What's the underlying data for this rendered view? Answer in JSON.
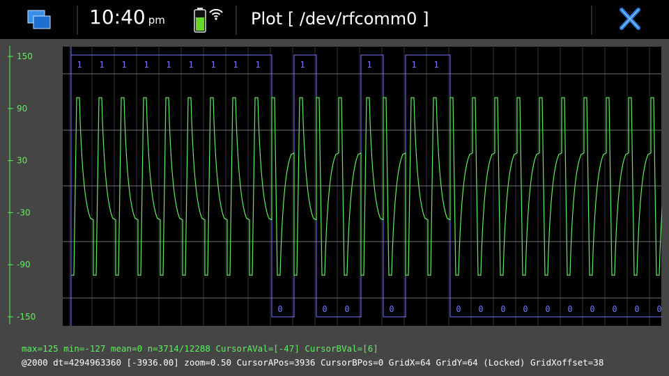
{
  "topbar": {
    "time": "10:40",
    "ampm": "pm",
    "title": "Plot [ /dev/rfcomm0 ]"
  },
  "icons": {
    "switcher": "task-switcher-icon",
    "battery": "battery-icon",
    "signal": "wifi-signal-icon",
    "close": "close-icon"
  },
  "colors": {
    "signal": "#5ef05e",
    "cursor": "#7a78ff",
    "grid": "#6e6e6e",
    "axis": "#5ef05e",
    "close": "#2a7fe0"
  },
  "status": {
    "line1": "max=125  min=-127  mean=0  n=3714/12288  CursorAVal=[-47]  CursorBVal=[6]",
    "line2": "@2000  dt=4294963360 [-3936.00] zoom=0.50  CursorAPos=3936  CursorBPos=0  GridX=64  GridY=64 (Locked) GridXoffset=38"
  },
  "chart_data": {
    "type": "line",
    "yticks": [
      "150",
      "90",
      "30",
      "-30",
      "-90",
      "-150"
    ],
    "ylim": [
      -150,
      150
    ],
    "grid": true,
    "signal": {
      "range": [
        -127,
        125
      ],
      "period_markers": [
        {
          "label": "1",
          "high": true
        },
        {
          "label": "1",
          "high": true
        },
        {
          "label": "1",
          "high": true
        },
        {
          "label": "1",
          "high": true
        },
        {
          "label": "1",
          "high": true
        },
        {
          "label": "1",
          "high": true
        },
        {
          "label": "1",
          "high": true
        },
        {
          "label": "1",
          "high": true
        },
        {
          "label": "1",
          "high": true
        },
        {
          "label": "0",
          "high": false
        },
        {
          "label": "1",
          "high": true
        },
        {
          "label": "0",
          "high": false
        },
        {
          "label": "0",
          "high": false
        },
        {
          "label": "1",
          "high": true
        },
        {
          "label": "0",
          "high": false
        },
        {
          "label": "1",
          "high": true
        },
        {
          "label": "1",
          "high": true
        },
        {
          "label": "0",
          "high": false
        },
        {
          "label": "0",
          "high": false
        },
        {
          "label": "0",
          "high": false
        },
        {
          "label": "0",
          "high": false
        },
        {
          "label": "0",
          "high": false
        },
        {
          "label": "0",
          "high": false
        },
        {
          "label": "0",
          "high": false
        },
        {
          "label": "0",
          "high": false
        },
        {
          "label": "0",
          "high": false
        },
        {
          "label": "0",
          "high": false
        }
      ]
    }
  }
}
